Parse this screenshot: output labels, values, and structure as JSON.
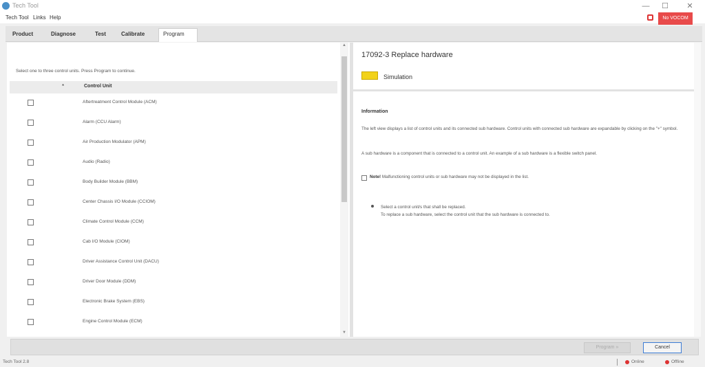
{
  "window": {
    "title": "Tech Tool",
    "minimize_glyph": "—",
    "maximize_glyph": "☐",
    "close_glyph": "✕",
    "icon": "app-logo-icon"
  },
  "menu": [
    "Tech Tool",
    "Links",
    "Help"
  ],
  "top_status": {
    "label": "No VOCOM",
    "color": "#e84a4a",
    "icon": "connection-warning-icon"
  },
  "tabs": [
    {
      "label": "Product",
      "active": false
    },
    {
      "label": "Diagnose",
      "active": false
    },
    {
      "label": "Test",
      "active": false
    },
    {
      "label": "Calibrate",
      "active": false
    },
    {
      "label": "Program",
      "active": true
    }
  ],
  "left": {
    "instruction": "Select one to three control units. Press Program to continue.",
    "header": {
      "star": "*",
      "column": "Control Unit"
    },
    "rows": [
      {
        "label": "Aftertreatment Control Module (ACM)"
      },
      {
        "label": "Alarm (CCU Alarm)"
      },
      {
        "label": "Air Production Modulator (APM)"
      },
      {
        "label": "Audio (Radio)"
      },
      {
        "label": "Body Builder Module (BBM)"
      },
      {
        "label": "Center Chassis I/O Module (CCIOM)"
      },
      {
        "label": "Climate Control Module (CCM)"
      },
      {
        "label": "Cab I/O Module (CIOM)"
      },
      {
        "label": "Driver Assistance Control Unit (DACU)"
      },
      {
        "label": "Driver Door Module (DDM)"
      },
      {
        "label": "Electronic Brake System (EBS)"
      },
      {
        "label": "Engine Control Module (ECM)"
      }
    ],
    "scroll_up": "▲",
    "scroll_down": "▼"
  },
  "right": {
    "title": "17092-3 Replace hardware",
    "mode_label": "Simulation",
    "mode_color": "#f2d21a",
    "info_heading": "Information",
    "para1": "The left view displays a list of control units and its connected sub hardware. Control units with connected sub hardware are expandable by clicking on the \"+\" symbol.",
    "para2": "A sub hardware is a component that is connected to a control unit. An example of a sub hardware is a flexible switch panel.",
    "note_icon": "note-icon",
    "note_label": "Note!",
    "note_text": "Malfunctioning control units or sub hardware may not be displayed in the list.",
    "bullet_line1": "Select a control unit/s that shall be replaced.",
    "bullet_line2": "To replace a sub hardware, select the control unit that the sub hardware is connected to."
  },
  "footer": {
    "program_label": "Program »",
    "program_enabled": false,
    "cancel_label": "Cancel"
  },
  "statusbar": {
    "left_text": "Tech Tool 2.8",
    "item1": "Online",
    "item2": "Offline",
    "status_color": "#d33333"
  }
}
